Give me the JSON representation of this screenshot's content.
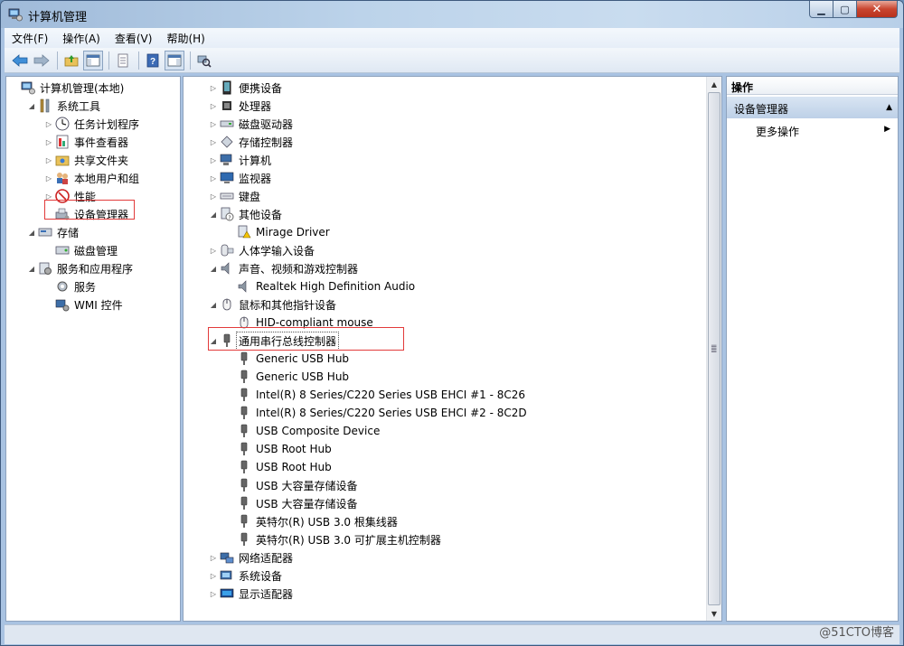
{
  "window": {
    "title": "计算机管理"
  },
  "menu": [
    "文件(F)",
    "操作(A)",
    "查看(V)",
    "帮助(H)"
  ],
  "left_tree": [
    {
      "label": "计算机管理(本地)",
      "level": 0,
      "expander": "none",
      "icon": "computer-management-icon"
    },
    {
      "label": "系统工具",
      "level": 1,
      "expander": "expanded",
      "icon": "tools-icon"
    },
    {
      "label": "任务计划程序",
      "level": 2,
      "expander": "collapsed",
      "icon": "task-scheduler-icon"
    },
    {
      "label": "事件查看器",
      "level": 2,
      "expander": "collapsed",
      "icon": "event-viewer-icon"
    },
    {
      "label": "共享文件夹",
      "level": 2,
      "expander": "collapsed",
      "icon": "shared-folder-icon"
    },
    {
      "label": "本地用户和组",
      "level": 2,
      "expander": "collapsed",
      "icon": "users-icon"
    },
    {
      "label": "性能",
      "level": 2,
      "expander": "collapsed",
      "icon": "performance-icon"
    },
    {
      "label": "设备管理器",
      "level": 2,
      "expander": "none",
      "icon": "device-manager-icon"
    },
    {
      "label": "存储",
      "level": 1,
      "expander": "expanded",
      "icon": "storage-icon"
    },
    {
      "label": "磁盘管理",
      "level": 2,
      "expander": "none",
      "icon": "disk-icon"
    },
    {
      "label": "服务和应用程序",
      "level": 1,
      "expander": "expanded",
      "icon": "services-apps-icon"
    },
    {
      "label": "服务",
      "level": 2,
      "expander": "none",
      "icon": "services-icon"
    },
    {
      "label": "WMI 控件",
      "level": 2,
      "expander": "none",
      "icon": "wmi-icon"
    }
  ],
  "device_tree": [
    {
      "label": "便携设备",
      "level": 0,
      "expander": "collapsed",
      "icon": "portable-device-icon"
    },
    {
      "label": "处理器",
      "level": 0,
      "expander": "collapsed",
      "icon": "processor-icon"
    },
    {
      "label": "磁盘驱动器",
      "level": 0,
      "expander": "collapsed",
      "icon": "disk-drive-icon"
    },
    {
      "label": "存储控制器",
      "level": 0,
      "expander": "collapsed",
      "icon": "storage-controller-icon"
    },
    {
      "label": "计算机",
      "level": 0,
      "expander": "collapsed",
      "icon": "computer-icon"
    },
    {
      "label": "监视器",
      "level": 0,
      "expander": "collapsed",
      "icon": "monitor-icon"
    },
    {
      "label": "键盘",
      "level": 0,
      "expander": "collapsed",
      "icon": "keyboard-icon"
    },
    {
      "label": "其他设备",
      "level": 0,
      "expander": "expanded",
      "icon": "other-devices-icon"
    },
    {
      "label": "Mirage Driver",
      "level": 1,
      "expander": "none",
      "icon": "warning-device-icon"
    },
    {
      "label": "人体学输入设备",
      "level": 0,
      "expander": "collapsed",
      "icon": "hid-icon"
    },
    {
      "label": "声音、视频和游戏控制器",
      "level": 0,
      "expander": "expanded",
      "icon": "speaker-icon"
    },
    {
      "label": "Realtek High Definition Audio",
      "level": 1,
      "expander": "none",
      "icon": "speaker-icon"
    },
    {
      "label": "鼠标和其他指针设备",
      "level": 0,
      "expander": "expanded",
      "icon": "mouse-icon"
    },
    {
      "label": "HID-compliant mouse",
      "level": 1,
      "expander": "none",
      "icon": "mouse-icon"
    },
    {
      "label": "通用串行总线控制器",
      "level": 0,
      "expander": "expanded",
      "icon": "usb-icon"
    },
    {
      "label": "Generic USB Hub",
      "level": 1,
      "expander": "none",
      "icon": "usb-icon"
    },
    {
      "label": "Generic USB Hub",
      "level": 1,
      "expander": "none",
      "icon": "usb-icon"
    },
    {
      "label": "Intel(R) 8 Series/C220 Series USB EHCI #1 - 8C26",
      "level": 1,
      "expander": "none",
      "icon": "usb-icon"
    },
    {
      "label": "Intel(R) 8 Series/C220 Series USB EHCI #2 - 8C2D",
      "level": 1,
      "expander": "none",
      "icon": "usb-icon"
    },
    {
      "label": "USB Composite Device",
      "level": 1,
      "expander": "none",
      "icon": "usb-icon"
    },
    {
      "label": "USB Root Hub",
      "level": 1,
      "expander": "none",
      "icon": "usb-icon"
    },
    {
      "label": "USB Root Hub",
      "level": 1,
      "expander": "none",
      "icon": "usb-icon"
    },
    {
      "label": "USB 大容量存储设备",
      "level": 1,
      "expander": "none",
      "icon": "usb-icon"
    },
    {
      "label": "USB 大容量存储设备",
      "level": 1,
      "expander": "none",
      "icon": "usb-icon"
    },
    {
      "label": "英特尔(R) USB 3.0 根集线器",
      "level": 1,
      "expander": "none",
      "icon": "usb-icon"
    },
    {
      "label": "英特尔(R) USB 3.0 可扩展主机控制器",
      "level": 1,
      "expander": "none",
      "icon": "usb-icon"
    },
    {
      "label": "网络适配器",
      "level": 0,
      "expander": "collapsed",
      "icon": "network-adapter-icon"
    },
    {
      "label": "系统设备",
      "level": 0,
      "expander": "collapsed",
      "icon": "system-device-icon"
    },
    {
      "label": "显示适配器",
      "level": 0,
      "expander": "collapsed",
      "icon": "display-adapter-icon"
    }
  ],
  "actions": {
    "header": "操作",
    "section": "设备管理器",
    "item": "更多操作"
  },
  "watermark": "@51CTO博客",
  "colors": {
    "highlight": "#e23b3b",
    "accent": "#2f5f9a"
  }
}
